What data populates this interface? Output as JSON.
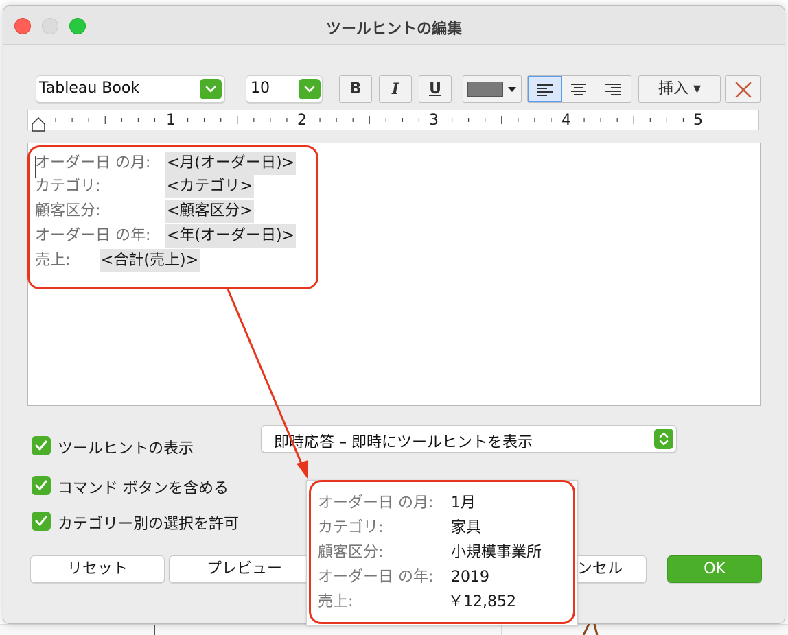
{
  "window": {
    "title": "ツールヒントの編集"
  },
  "toolbar": {
    "font_name": "Tableau Book",
    "font_size": "10",
    "bold_label": "B",
    "italic_label": "I",
    "underline_label": "U",
    "text_color": "#7a7a7a",
    "insert_label": "挿入 ▾"
  },
  "ruler": {
    "marks": [
      "1",
      "2",
      "3",
      "4",
      "5"
    ]
  },
  "editor": {
    "rows": [
      {
        "label": "オーダー日 の月:",
        "field": "<月(オーダー日)>"
      },
      {
        "label": "カテゴリ:",
        "field": "<カテゴリ>"
      },
      {
        "label": "顧客区分:",
        "field": "<顧客区分>"
      },
      {
        "label": "オーダー日 の年:",
        "field": "<年(オーダー日)>"
      },
      {
        "label": "売上:",
        "field": "<合計(売上)>"
      }
    ]
  },
  "options": {
    "show_tooltip": "ツールヒントの表示",
    "include_commands": "コマンド ボタンを含める",
    "allow_category_select": "カテゴリー別の選択を許可",
    "response_mode": "即時応答 – 即時にツールヒントを表示"
  },
  "buttons": {
    "reset": "リセット",
    "preview": "プレビュー",
    "cancel": "ンセル",
    "ok": "OK"
  },
  "preview": {
    "rows": [
      {
        "label": "オーダー日 の月:",
        "value": "1月"
      },
      {
        "label": "カテゴリ:",
        "value": "家具"
      },
      {
        "label": "顧客区分:",
        "value": "小規模事業所"
      },
      {
        "label": "オーダー日 の年:",
        "value": "2019"
      },
      {
        "label": "売上:",
        "value": "￥12,852"
      }
    ]
  },
  "colors": {
    "accent_green": "#4caf2a",
    "callout_red": "#e8361e"
  }
}
